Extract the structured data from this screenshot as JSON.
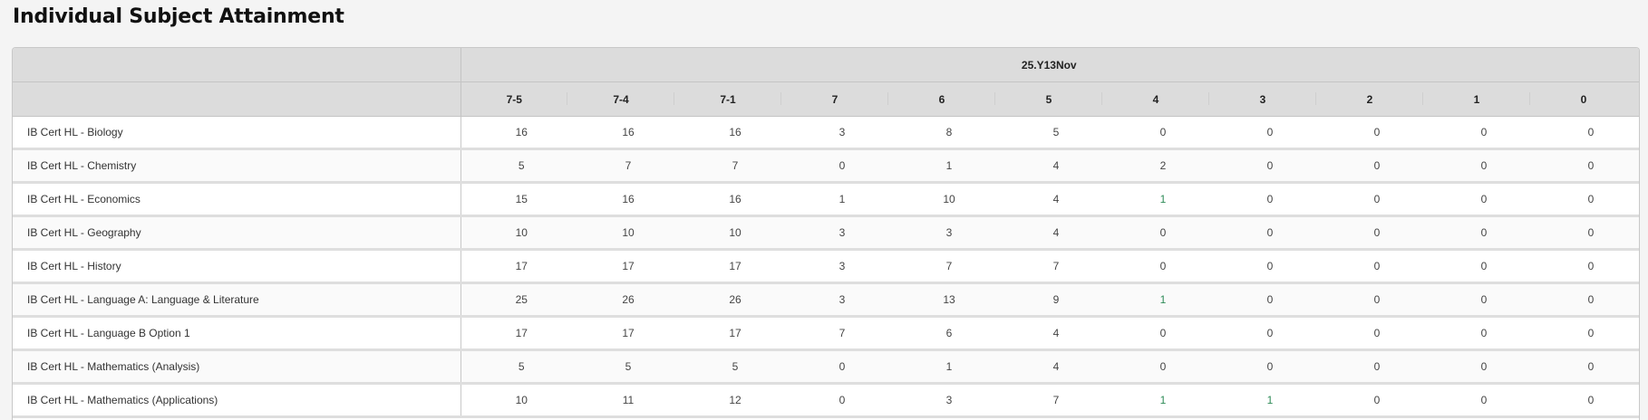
{
  "page": {
    "title": "Individual Subject Attainment"
  },
  "table": {
    "group_header": "25.Y13Nov",
    "grades": [
      "7-5",
      "7-4",
      "7-1",
      "7",
      "6",
      "5",
      "4",
      "3",
      "2",
      "1",
      "0"
    ],
    "highlight_color": "#2e8b57",
    "rows": [
      {
        "subject": "IB Cert HL - Biology",
        "values": [
          "16",
          "16",
          "16",
          "3",
          "8",
          "5",
          "0",
          "0",
          "0",
          "0",
          "0"
        ],
        "highlight": []
      },
      {
        "subject": "IB Cert HL - Chemistry",
        "values": [
          "5",
          "7",
          "7",
          "0",
          "1",
          "4",
          "2",
          "0",
          "0",
          "0",
          "0"
        ],
        "highlight": []
      },
      {
        "subject": "IB Cert HL - Economics",
        "values": [
          "15",
          "16",
          "16",
          "1",
          "10",
          "4",
          "1",
          "0",
          "0",
          "0",
          "0"
        ],
        "highlight": [
          6
        ]
      },
      {
        "subject": "IB Cert HL - Geography",
        "values": [
          "10",
          "10",
          "10",
          "3",
          "3",
          "4",
          "0",
          "0",
          "0",
          "0",
          "0"
        ],
        "highlight": []
      },
      {
        "subject": "IB Cert HL - History",
        "values": [
          "17",
          "17",
          "17",
          "3",
          "7",
          "7",
          "0",
          "0",
          "0",
          "0",
          "0"
        ],
        "highlight": []
      },
      {
        "subject": "IB Cert HL - Language A: Language & Literature",
        "values": [
          "25",
          "26",
          "26",
          "3",
          "13",
          "9",
          "1",
          "0",
          "0",
          "0",
          "0"
        ],
        "highlight": [
          6
        ]
      },
      {
        "subject": "IB Cert HL - Language B Option 1",
        "values": [
          "17",
          "17",
          "17",
          "7",
          "6",
          "4",
          "0",
          "0",
          "0",
          "0",
          "0"
        ],
        "highlight": []
      },
      {
        "subject": "IB Cert HL - Mathematics (Analysis)",
        "values": [
          "5",
          "5",
          "5",
          "0",
          "1",
          "4",
          "0",
          "0",
          "0",
          "0",
          "0"
        ],
        "highlight": []
      },
      {
        "subject": "IB Cert HL - Mathematics (Applications)",
        "values": [
          "10",
          "11",
          "12",
          "0",
          "3",
          "7",
          "1",
          "1",
          "0",
          "0",
          "0"
        ],
        "highlight": [
          6,
          7
        ]
      }
    ]
  }
}
